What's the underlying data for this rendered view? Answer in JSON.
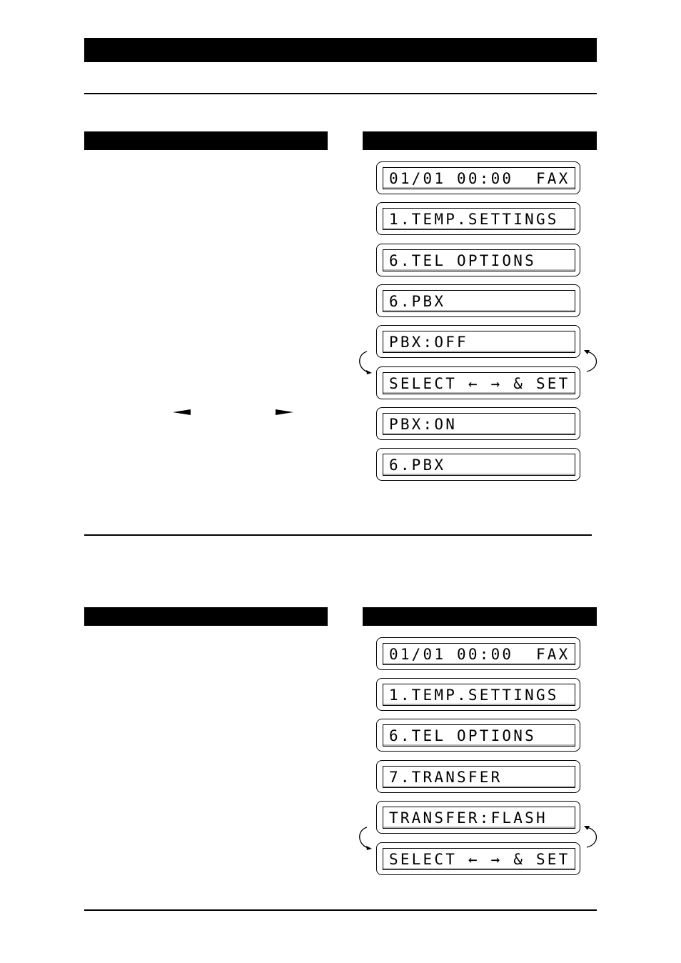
{
  "document": {
    "header_bar": "",
    "sections": [
      {
        "id": "pbx",
        "left_heading": "",
        "right_heading": "",
        "nav_glyphs": {
          "left": "left-triangle",
          "right": "right-triangle"
        },
        "lcd_screens": [
          "01/01 00:00  FAX",
          "1.TEMP.SETTINGS",
          "6.TEL OPTIONS",
          "6.PBX",
          "PBX:OFF",
          "SELECT ← → & SET",
          "PBX:ON",
          "6.PBX"
        ],
        "cycle_between": [
          "PBX:OFF",
          "SELECT ← → & SET"
        ]
      },
      {
        "id": "transfer",
        "left_heading": "",
        "right_heading": "",
        "lcd_screens": [
          "01/01 00:00  FAX",
          "1.TEMP.SETTINGS",
          "6.TEL OPTIONS",
          "7.TRANSFER",
          "TRANSFER:FLASH",
          "SELECT ← → & SET"
        ],
        "cycle_between": [
          "TRANSFER:FLASH",
          "SELECT ← → & SET"
        ]
      }
    ]
  }
}
